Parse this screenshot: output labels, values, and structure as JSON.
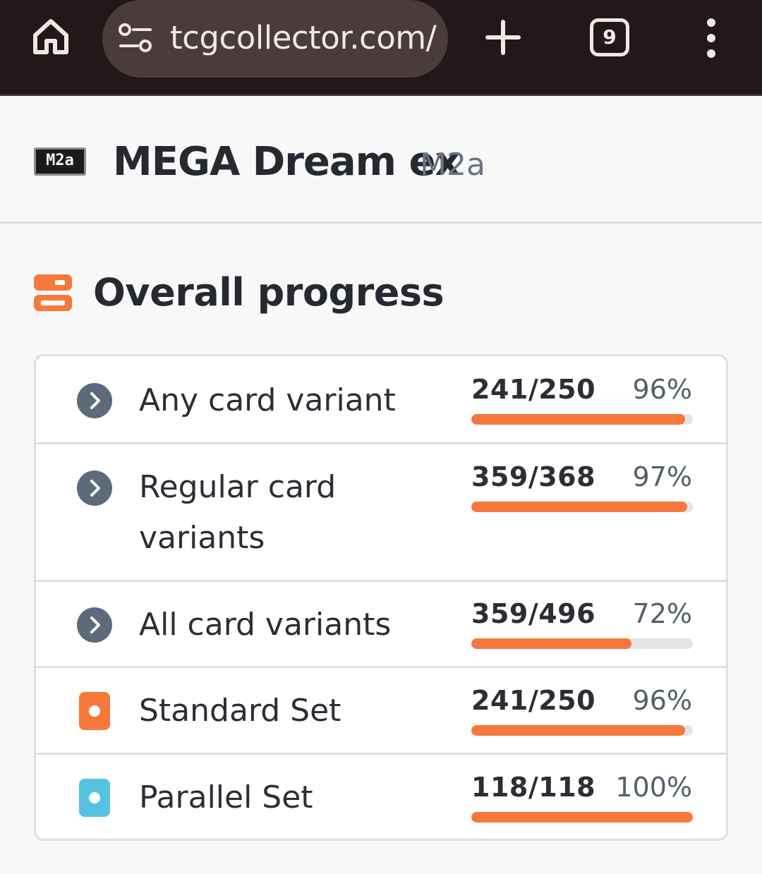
{
  "browser": {
    "url": "tcgcollector.com/",
    "tab_count": "9",
    "icons": [
      "home-icon",
      "site-settings-icon",
      "new-tab-icon",
      "tab-switcher-icon",
      "more-menu-icon"
    ]
  },
  "header": {
    "logo_text": "M2a",
    "title": "MEGA Dream ex",
    "code": "M2a"
  },
  "progress": {
    "heading": "Overall progress",
    "accent_color": "#f6783a",
    "rows": [
      {
        "label": "Any card variant",
        "count": "241/250",
        "percent": "96%",
        "fraction": 0.964,
        "icon": "chevron-right-icon"
      },
      {
        "label": "Regular card variants",
        "count": "359/368",
        "percent": "97%",
        "fraction": 0.976,
        "icon": "chevron-right-icon"
      },
      {
        "label": "All card variants",
        "count": "359/496",
        "percent": "72%",
        "fraction": 0.724,
        "icon": "chevron-right-icon"
      },
      {
        "label": "Standard Set",
        "count": "241/250",
        "percent": "96%",
        "fraction": 0.964,
        "icon": "standard-set-icon",
        "icon_color": "#f6783a"
      },
      {
        "label": "Parallel Set",
        "count": "118/118",
        "percent": "100%",
        "fraction": 1.0,
        "icon": "parallel-set-icon",
        "icon_color": "#55c3e0"
      }
    ]
  }
}
